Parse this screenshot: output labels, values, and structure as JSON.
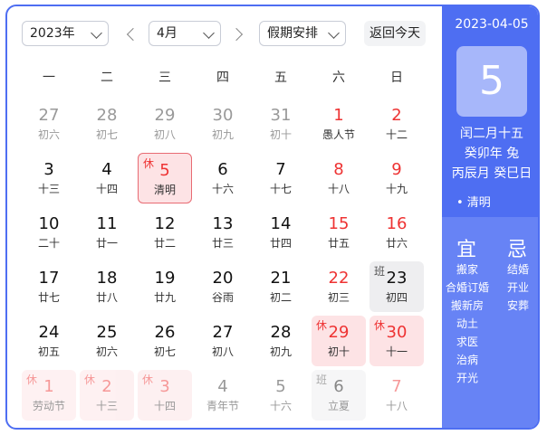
{
  "toolbar": {
    "year_select": "2023年",
    "month_select": "4月",
    "holiday_select": "假期安排",
    "today_button": "返回今天"
  },
  "weekdays": [
    "一",
    "二",
    "三",
    "四",
    "五",
    "六",
    "日"
  ],
  "days": [
    {
      "n": "27",
      "s": "初六",
      "t": "other"
    },
    {
      "n": "28",
      "s": "初七",
      "t": "other"
    },
    {
      "n": "29",
      "s": "初八",
      "t": "other"
    },
    {
      "n": "30",
      "s": "初九",
      "t": "other"
    },
    {
      "n": "31",
      "s": "初十",
      "t": "other"
    },
    {
      "n": "1",
      "s": "愚人节",
      "t": "wknd"
    },
    {
      "n": "2",
      "s": "十二",
      "t": "wknd"
    },
    {
      "n": "3",
      "s": "十三",
      "t": "normal"
    },
    {
      "n": "4",
      "s": "十四",
      "t": "normal"
    },
    {
      "n": "5",
      "s": "清明",
      "t": "rest today",
      "b": "休"
    },
    {
      "n": "6",
      "s": "十六",
      "t": "normal"
    },
    {
      "n": "7",
      "s": "十七",
      "t": "normal"
    },
    {
      "n": "8",
      "s": "十八",
      "t": "wknd"
    },
    {
      "n": "9",
      "s": "十九",
      "t": "wknd"
    },
    {
      "n": "10",
      "s": "二十",
      "t": "normal"
    },
    {
      "n": "11",
      "s": "廿一",
      "t": "normal"
    },
    {
      "n": "12",
      "s": "廿二",
      "t": "normal"
    },
    {
      "n": "13",
      "s": "廿三",
      "t": "normal"
    },
    {
      "n": "14",
      "s": "廿四",
      "t": "normal"
    },
    {
      "n": "15",
      "s": "廿五",
      "t": "wknd"
    },
    {
      "n": "16",
      "s": "廿六",
      "t": "wknd"
    },
    {
      "n": "17",
      "s": "廿七",
      "t": "normal"
    },
    {
      "n": "18",
      "s": "廿八",
      "t": "normal"
    },
    {
      "n": "19",
      "s": "廿九",
      "t": "normal"
    },
    {
      "n": "20",
      "s": "谷雨",
      "t": "normal"
    },
    {
      "n": "21",
      "s": "初二",
      "t": "normal"
    },
    {
      "n": "22",
      "s": "初三",
      "t": "wknd"
    },
    {
      "n": "23",
      "s": "初四",
      "t": "work",
      "b": "班"
    },
    {
      "n": "24",
      "s": "初五",
      "t": "normal"
    },
    {
      "n": "25",
      "s": "初六",
      "t": "normal"
    },
    {
      "n": "26",
      "s": "初七",
      "t": "normal"
    },
    {
      "n": "27",
      "s": "初八",
      "t": "normal"
    },
    {
      "n": "28",
      "s": "初九",
      "t": "normal"
    },
    {
      "n": "29",
      "s": "初十",
      "t": "rest",
      "b": "休"
    },
    {
      "n": "30",
      "s": "十一",
      "t": "rest",
      "b": "休"
    },
    {
      "n": "1",
      "s": "劳动节",
      "t": "rest faded",
      "b": "休"
    },
    {
      "n": "2",
      "s": "十三",
      "t": "rest faded",
      "b": "休"
    },
    {
      "n": "3",
      "s": "十四",
      "t": "rest faded",
      "b": "休"
    },
    {
      "n": "4",
      "s": "青年节",
      "t": "other"
    },
    {
      "n": "5",
      "s": "十六",
      "t": "other"
    },
    {
      "n": "6",
      "s": "立夏",
      "t": "work faded",
      "b": "班"
    },
    {
      "n": "7",
      "s": "十八",
      "t": "wknd faded"
    }
  ],
  "side": {
    "date": "2023-04-05",
    "day": "5",
    "lunar": "闰二月十五",
    "ganzhi_year": "癸卯年 兔",
    "ganzhi_month_day": "丙辰月 癸巳日",
    "festival": "• 清明",
    "yi_label": "宜",
    "ji_label": "忌",
    "yi_items": [
      "搬家",
      "合婚订婚",
      "搬新房",
      "动土",
      "求医",
      "治病",
      "开光"
    ],
    "ji_items": [
      "结婚",
      "开业",
      "安葬"
    ]
  }
}
